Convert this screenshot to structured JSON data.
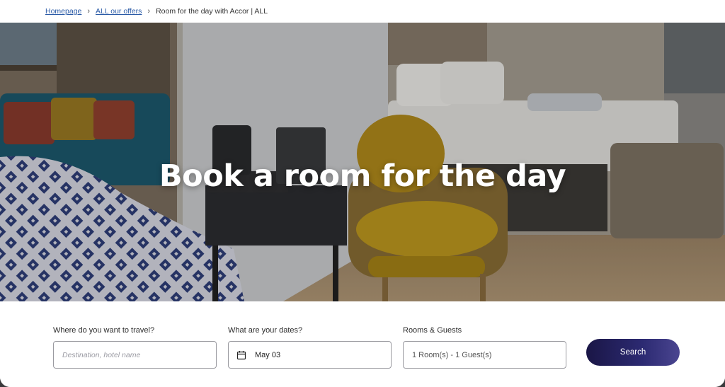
{
  "breadcrumb": {
    "items": [
      {
        "label": "Homepage"
      },
      {
        "label": "ALL our offers"
      },
      {
        "label": "Room for the day with Accor | ALL"
      }
    ]
  },
  "hero": {
    "title": "Book a room for the day"
  },
  "search": {
    "destination": {
      "label": "Where do you want to travel?",
      "placeholder": "Destination, hotel name",
      "value": ""
    },
    "dates": {
      "label": "What are your dates?",
      "value": "May 03",
      "icon": "calendar-icon"
    },
    "rooms": {
      "label": "Rooms & Guests",
      "value": "1 Room(s) - 1 Guest(s)"
    },
    "button_label": "Search",
    "button_colors": [
      "#1a1646",
      "#4a4590"
    ]
  }
}
